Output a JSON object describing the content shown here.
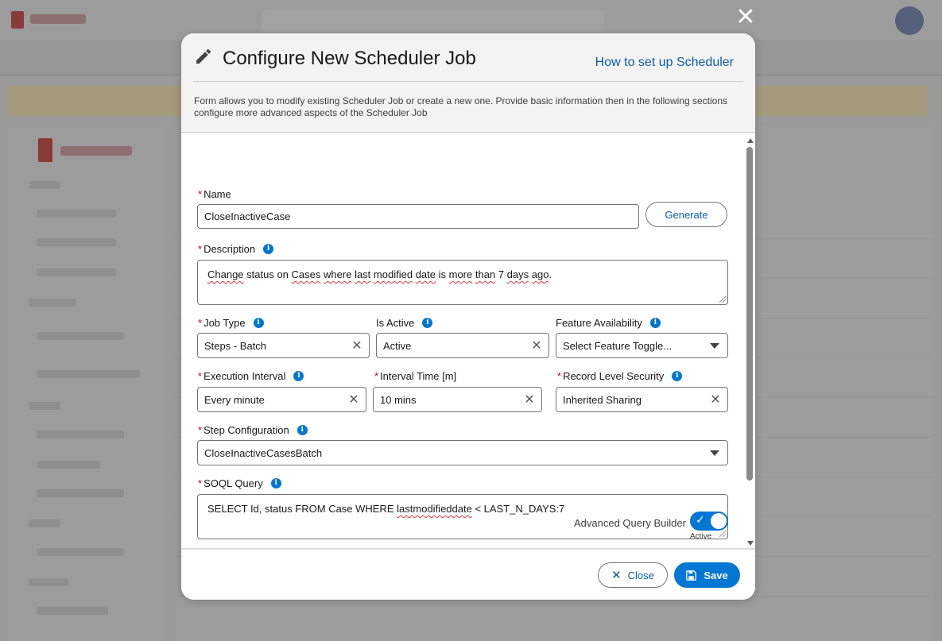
{
  "modal": {
    "title": "Configure New Scheduler Job",
    "help_link": "How to set up Scheduler",
    "description": "Form allows you to modify existing Scheduler Job or create a new one. Provide basic information then in the following sections configure more advanced aspects of the Scheduler Job"
  },
  "form": {
    "required_mark": "*",
    "info_glyph": "i",
    "name": {
      "label": "Name",
      "value": "CloseInactiveCase",
      "generate_label": "Generate"
    },
    "description": {
      "label": "Description",
      "value_parts": [
        "Change",
        " status on ",
        "Cases",
        " ",
        "where",
        " ",
        "last",
        " ",
        "modified",
        " ",
        "date",
        " is ",
        "more",
        " ",
        "than",
        " 7 ",
        "days",
        " ",
        "ago",
        "."
      ]
    },
    "job_type": {
      "label": "Job Type",
      "value": "Steps - Batch"
    },
    "is_active": {
      "label": "Is Active",
      "value": "Active"
    },
    "feature_availability": {
      "label": "Feature Availability",
      "value": "Select Feature Toggle..."
    },
    "execution_interval": {
      "label": "Execution Interval",
      "value": "Every minute"
    },
    "interval_time": {
      "label": "Interval Time [m]",
      "value": "10 mins"
    },
    "record_level_security": {
      "label": "Record Level Security",
      "value": "Inherited Sharing"
    },
    "step_configuration": {
      "label": "Step Configuration",
      "value": "CloseInactiveCasesBatch"
    },
    "soql_query": {
      "label": "SOQL Query",
      "value_before": "SELECT Id, status FROM Case WHERE ",
      "value_spell": "lastmodifieddate",
      "value_after": " < LAST_N_DAYS:7"
    },
    "advanced_query_builder": {
      "label": "Advanced Query Builder",
      "state": "Active",
      "on": true
    }
  },
  "footer": {
    "close_label": "Close",
    "save_label": "Save"
  },
  "colors": {
    "brand": "#0176d3",
    "link": "#0b5cab",
    "required": "#ba0517"
  }
}
